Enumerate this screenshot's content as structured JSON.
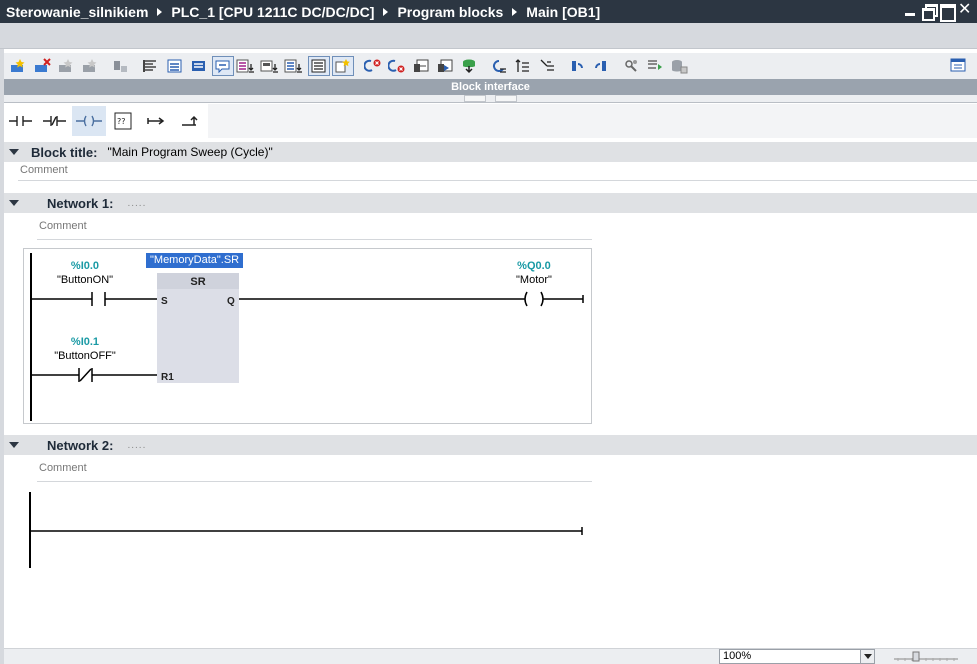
{
  "window": {
    "breadcrumb": [
      "Sterowanie_silnikiem",
      "PLC_1 [CPU 1211C DC/DC/DC]",
      "Program blocks",
      "Main [OB1]"
    ]
  },
  "toolbar": {
    "icons": [
      "insert-network-icon",
      "delete-network-icon",
      "insert-row-icon",
      "add-row-icon",
      "reset-start-values-icon",
      "absolute-operands-icon",
      "favorites-icon",
      "network-comments-icon",
      "comment-toggle-icon",
      "open-all-networks-icon",
      "close-all-networks-icon",
      "operand-display-icon",
      "display-toggle-icon",
      "go-to-next-error-icon",
      "go-to-previous-error-icon",
      "monitor-icon",
      "snapshot-icon",
      "update-inputs-icon",
      "compare-icon",
      "load-icon",
      "toggle-breakpoint-icon",
      "step-icon",
      "step-over-icon",
      "test-icon",
      "properties-icon",
      "download-icon",
      "block-interface-toggle-icon"
    ]
  },
  "block_interface": {
    "label": "Block interface"
  },
  "lad_elements": [
    "no-contact-icon",
    "nc-contact-icon",
    "coil-icon",
    "empty-box-icon",
    "open-branch-icon",
    "close-branch-icon"
  ],
  "block": {
    "title_label": "Block title:",
    "title_value": "\"Main Program Sweep (Cycle)\"",
    "comment": "Comment"
  },
  "networks": [
    {
      "label": "Network 1:",
      "title": ".....",
      "comment": "Comment",
      "contact1": {
        "address": "%I0.0",
        "name": "\"ButtonON\""
      },
      "contact2": {
        "address": "%I0.1",
        "name": "\"ButtonOFF\""
      },
      "sr": {
        "instance": "\"MemoryData\".SR",
        "type": "SR",
        "pin_s": "S",
        "pin_r1": "R1",
        "pin_q": "Q"
      },
      "coil": {
        "address": "%Q0.0",
        "name": "\"Motor\""
      }
    },
    {
      "label": "Network 2:",
      "title": ".....",
      "comment": "Comment"
    }
  ],
  "status": {
    "zoom": "100%"
  }
}
